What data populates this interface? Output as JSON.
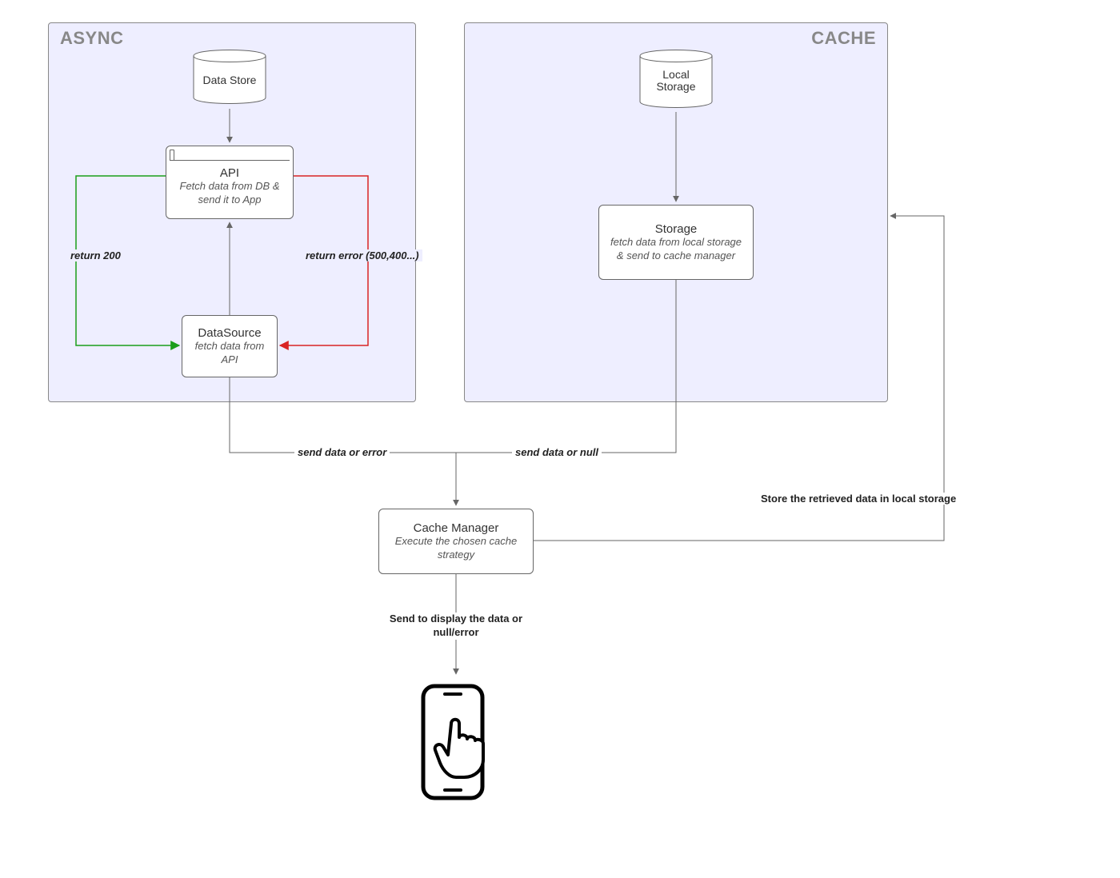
{
  "containers": {
    "async": {
      "label": "ASYNC"
    },
    "cache": {
      "label": "CACHE"
    }
  },
  "nodes": {
    "dataStore": {
      "title": "Data Store",
      "subtitle": ""
    },
    "api": {
      "title": "API",
      "subtitle": "Fetch data from DB & send it to App"
    },
    "dataSource": {
      "title": "DataSource",
      "subtitle": "fetch data from API"
    },
    "localStorage": {
      "title": "Local Storage",
      "subtitle": ""
    },
    "storage": {
      "title": "Storage",
      "subtitle": "fetch data from local storage & send to cache manager"
    },
    "cacheManager": {
      "title": "Cache Manager",
      "subtitle": "Execute the chosen cache strategy"
    }
  },
  "edges": {
    "return200": "return 200",
    "returnError": "return error (500,400...)",
    "sendDataOrError": "send data or error",
    "sendDataOrNull": "send data or null",
    "storeRetrieved": "Store the retrieved data in local storage",
    "sendToDisplay": "Send to display the data or null/error"
  },
  "colors": {
    "success": "#1a9e1a",
    "error": "#d92424",
    "line": "#666666",
    "containerBg": "#eeeeff"
  }
}
